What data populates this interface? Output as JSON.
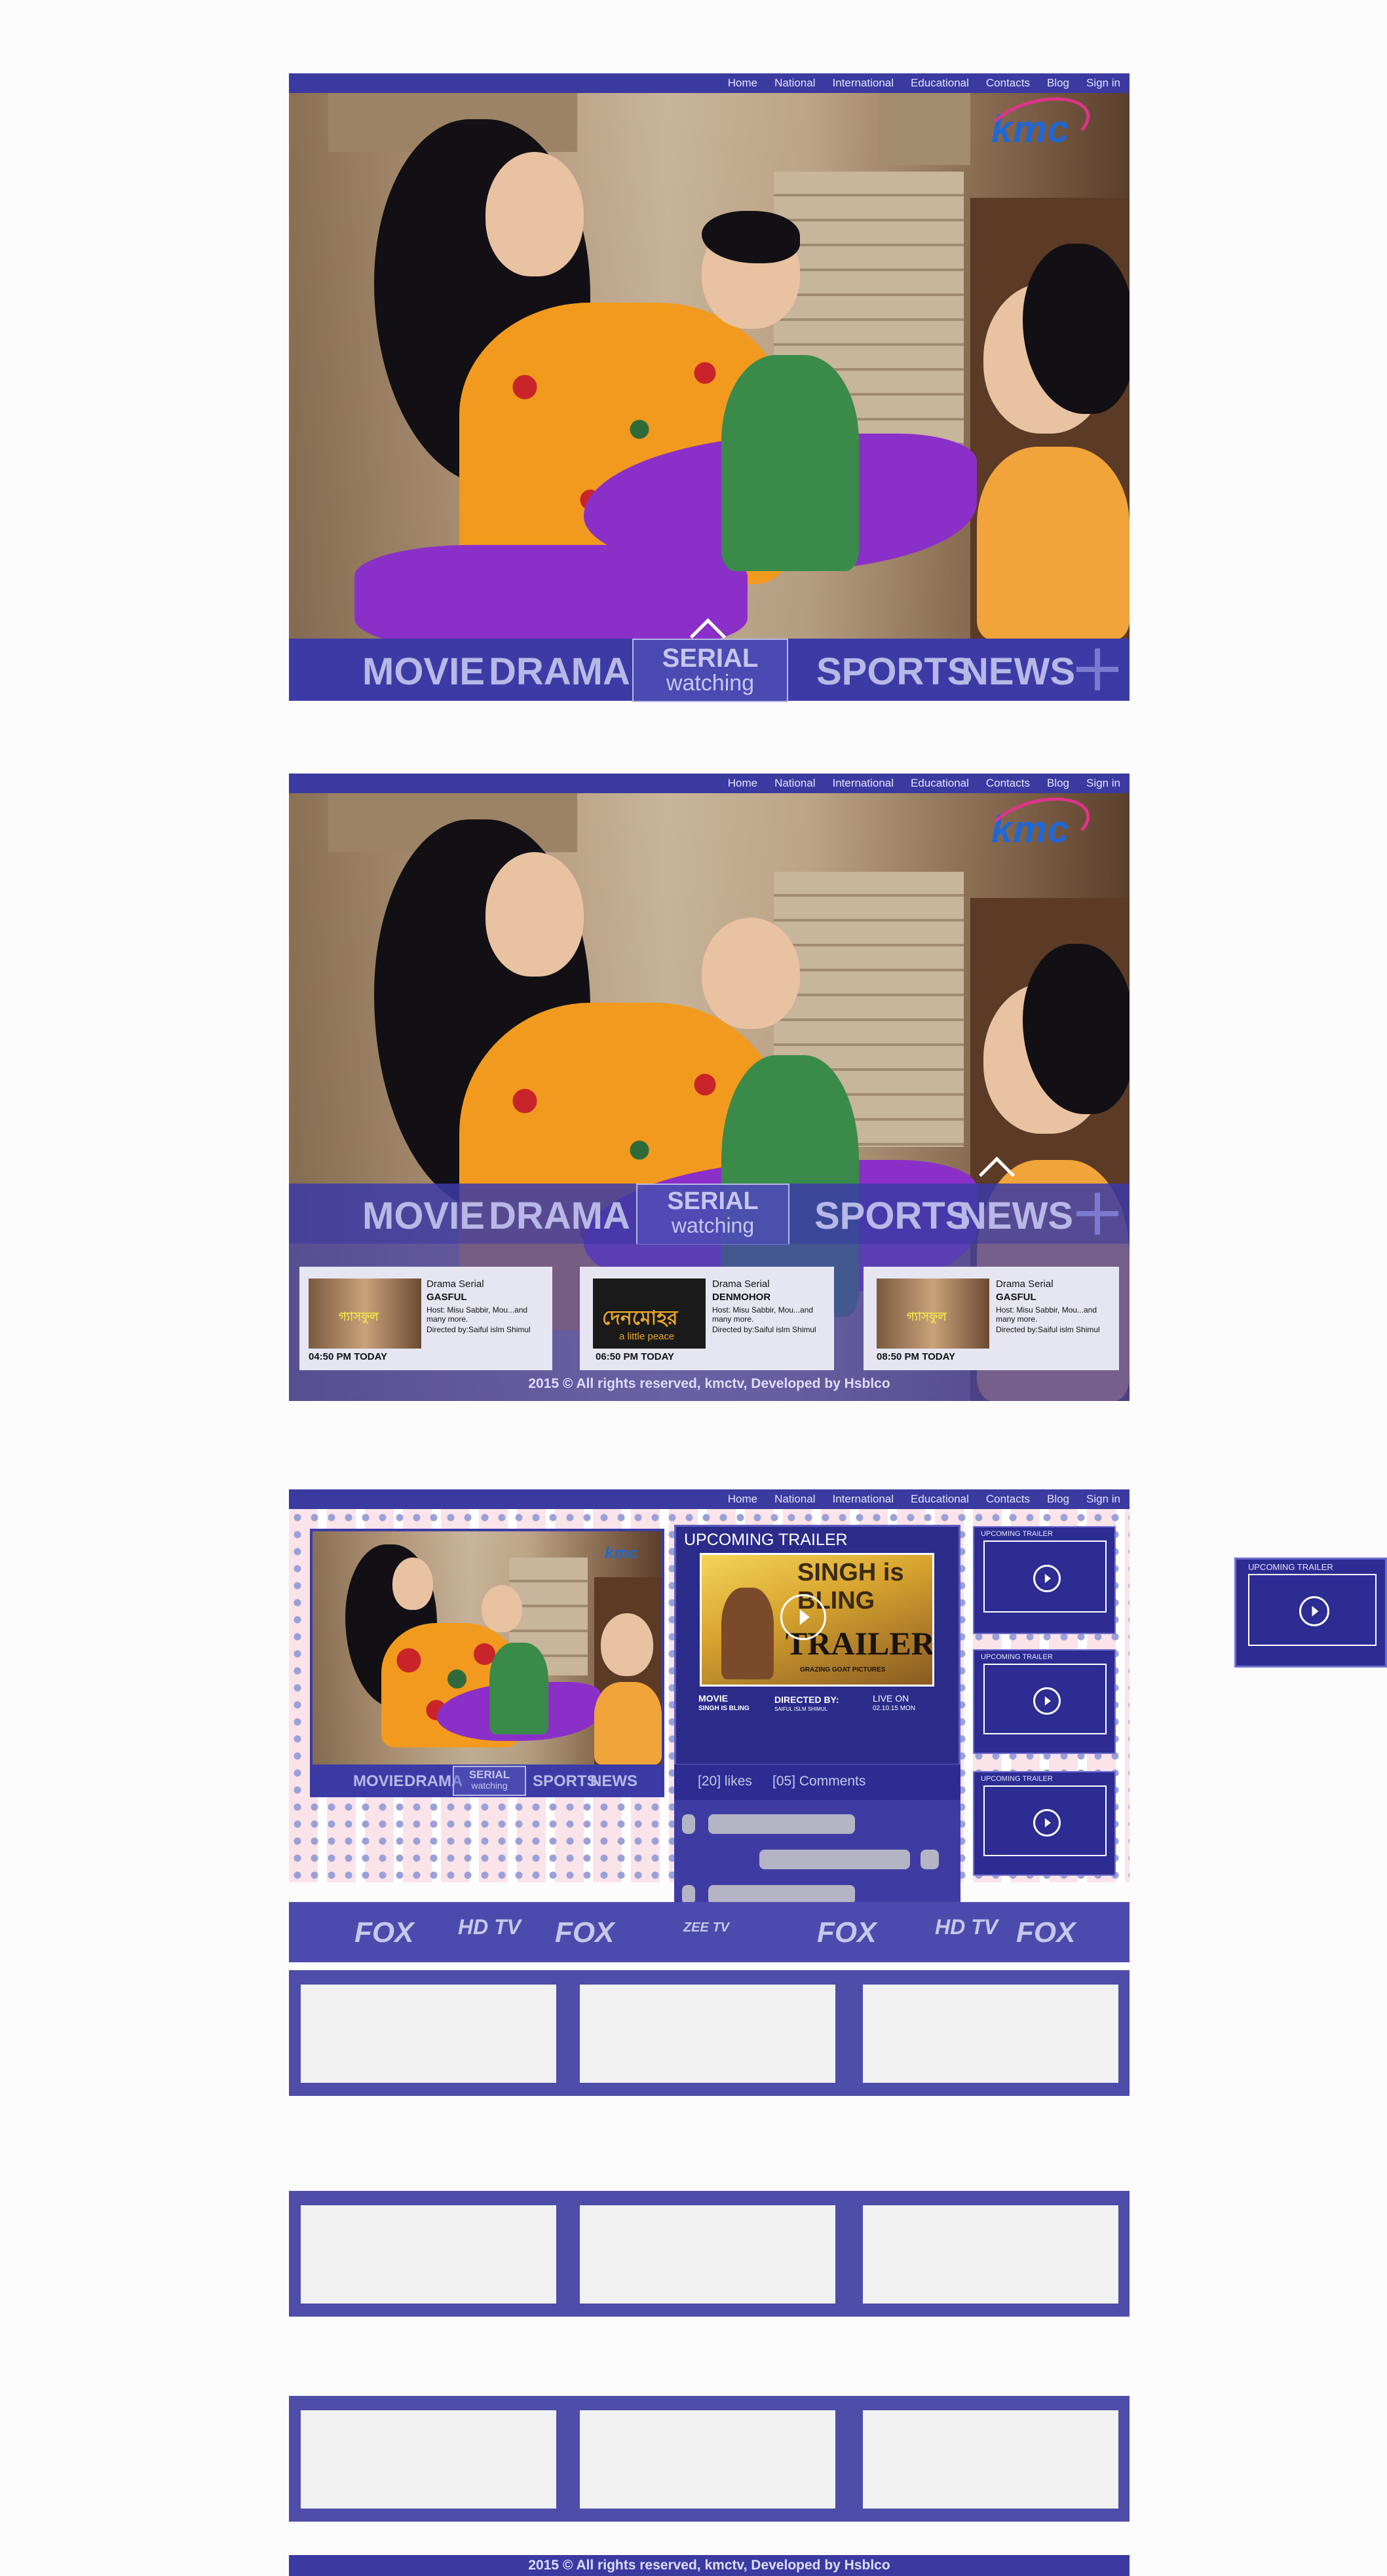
{
  "nav": {
    "items": [
      "Home",
      "National",
      "International",
      "Educational",
      "Contacts",
      "Blog",
      "Sign in"
    ]
  },
  "logo": {
    "text": "kmc"
  },
  "categories": {
    "movie": "MOVIE",
    "drama": "DRAMA",
    "serial": "SERIAL",
    "watching": "watching",
    "sports": "SPORTS",
    "news": "NEWS"
  },
  "schedule": [
    {
      "genre": "Drama Serial",
      "title": "GASFUL",
      "host": "Host: Misu Sabbir, Mou...and many more.",
      "director": "Directed by:Saiful islm Shimul",
      "time": "04:50 PM TODAY",
      "poster": "গ্যাসফুল"
    },
    {
      "genre": "Drama Serial",
      "title": "DENMOHOR",
      "host": "Host: Misu Sabbir, Mou...and many more.",
      "director": "Directed by:Saiful islm Shimul",
      "time": "06:50 PM TODAY",
      "poster": "দেনমোহর",
      "poster_sub": "a little peace"
    },
    {
      "genre": "Drama Serial",
      "title": "GASFUL",
      "host": "Host: Misu Sabbir, Mou...and many more.",
      "director": "Directed by:Saiful islm Shimul",
      "time": "08:50 PM TODAY",
      "poster": "গ্যাসফুল"
    }
  ],
  "footer": "2015 © All rights reserved, kmctv, Developed by Hsblco",
  "trailer": {
    "heading": "UPCOMING TRAILER",
    "poster_title": "SINGH is BLING",
    "poster_word": "TRAILER",
    "poster_credit": "GRAZING GOAT PICTURES",
    "movie_label": "MOVIE",
    "movie_name": "SINGH IS BLING",
    "directed_label": "DIRECTED BY:",
    "director": "SAIFUL ISLM SHIMUL",
    "live_label": "LIVE ON",
    "live_date": "02.10.15 MON",
    "likes": "[20] likes",
    "comments": "[05] Comments"
  },
  "mini_trailers": [
    {
      "heading": "UPCOMING TRAILER"
    },
    {
      "heading": "UPCOMING TRAILER"
    },
    {
      "heading": "UPCOMING TRAILER"
    }
  ],
  "side_trailer": {
    "heading": "UPCOMING TRAILER"
  },
  "channels": [
    "FOX",
    "HD TV",
    "FOX",
    "ZEE TV",
    "FOX",
    "HD TV",
    "FOX"
  ],
  "channel_sub": {
    "hd": "TV",
    "zee": "ZEE TV"
  },
  "colors": {
    "primary": "#3b3aa0",
    "accent": "#e0338a",
    "logo_blue": "#1f67d6"
  }
}
